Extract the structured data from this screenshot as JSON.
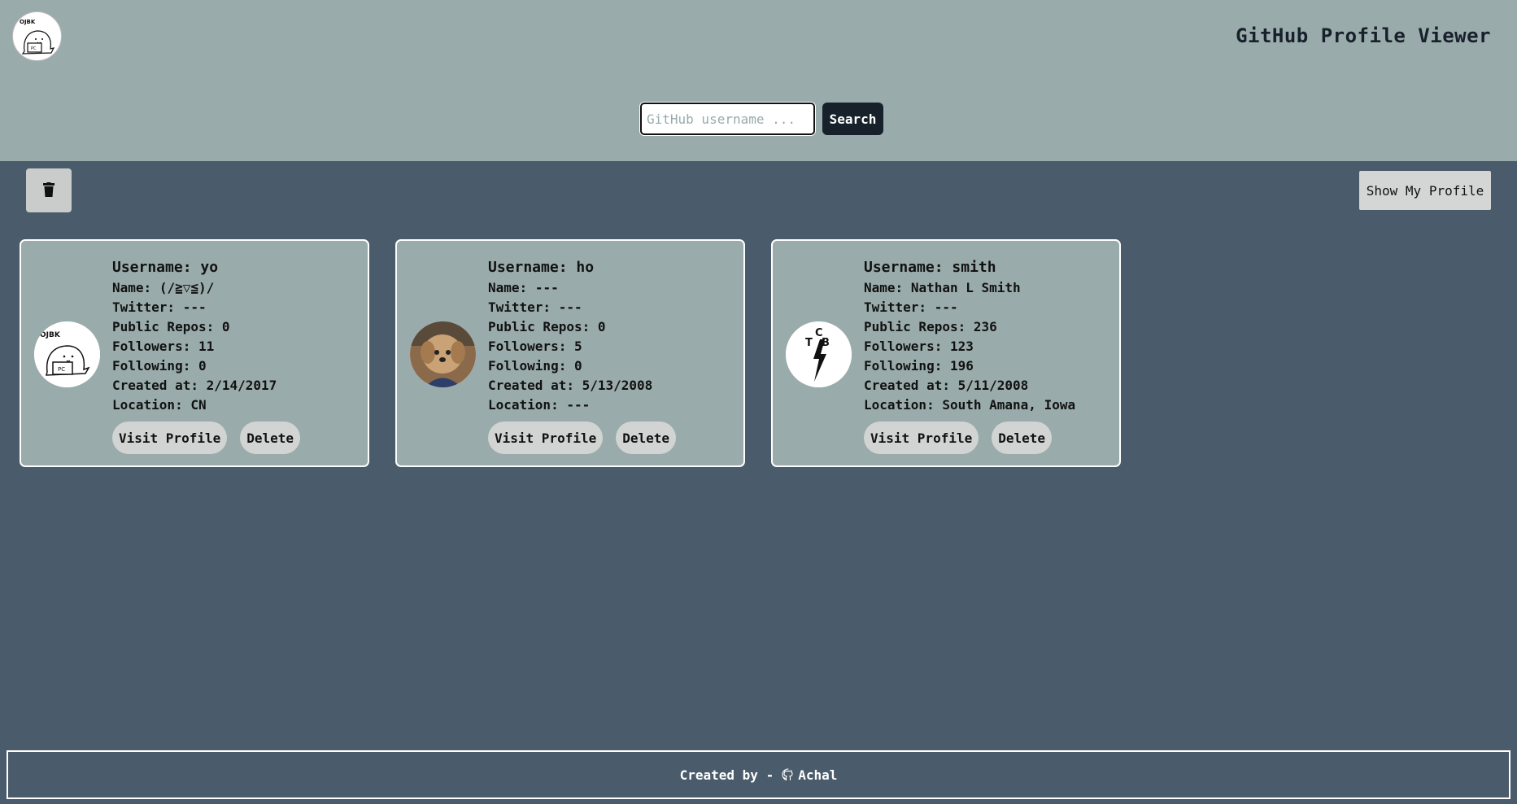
{
  "header": {
    "title": "GitHub Profile Viewer",
    "logo_icon": "cartoon-cat-laptop-logo"
  },
  "search": {
    "placeholder": "GitHub username ...",
    "value": "",
    "button_label": "Search"
  },
  "toolbar": {
    "trash_icon": "trash-icon",
    "show_profile_label": "Show My Profile"
  },
  "labels": {
    "username": "Username:",
    "name": "Name:",
    "twitter": "Twitter:",
    "repos": "Public Repos:",
    "followers": "Followers:",
    "following": "Following:",
    "created": "Created at:",
    "location": "Location:",
    "visit": "Visit Profile",
    "delete": "Delete"
  },
  "profiles": [
    {
      "username": "yo",
      "name": "(/≧▽≦)/",
      "twitter": "---",
      "repos": "0",
      "followers": "11",
      "following": "0",
      "created": "2/14/2017",
      "location": "CN",
      "avatar": "cartoon-cat-laptop"
    },
    {
      "username": "ho",
      "name": "---",
      "twitter": "---",
      "repos": "0",
      "followers": "5",
      "following": "0",
      "created": "5/13/2008",
      "location": "---",
      "avatar": "dog-photo"
    },
    {
      "username": "smith",
      "name": "Nathan L Smith",
      "twitter": "---",
      "repos": "236",
      "followers": "123",
      "following": "196",
      "created": "5/11/2008",
      "location": "South Amana, Iowa",
      "avatar": "tcb-lightning-logo"
    }
  ],
  "footer": {
    "prefix": "Created by -",
    "author": "Achal",
    "icon": "github-icon"
  },
  "colors": {
    "header_bg": "#9aabab",
    "body_bg": "#4a5b6b",
    "search_button": "#17212b"
  }
}
